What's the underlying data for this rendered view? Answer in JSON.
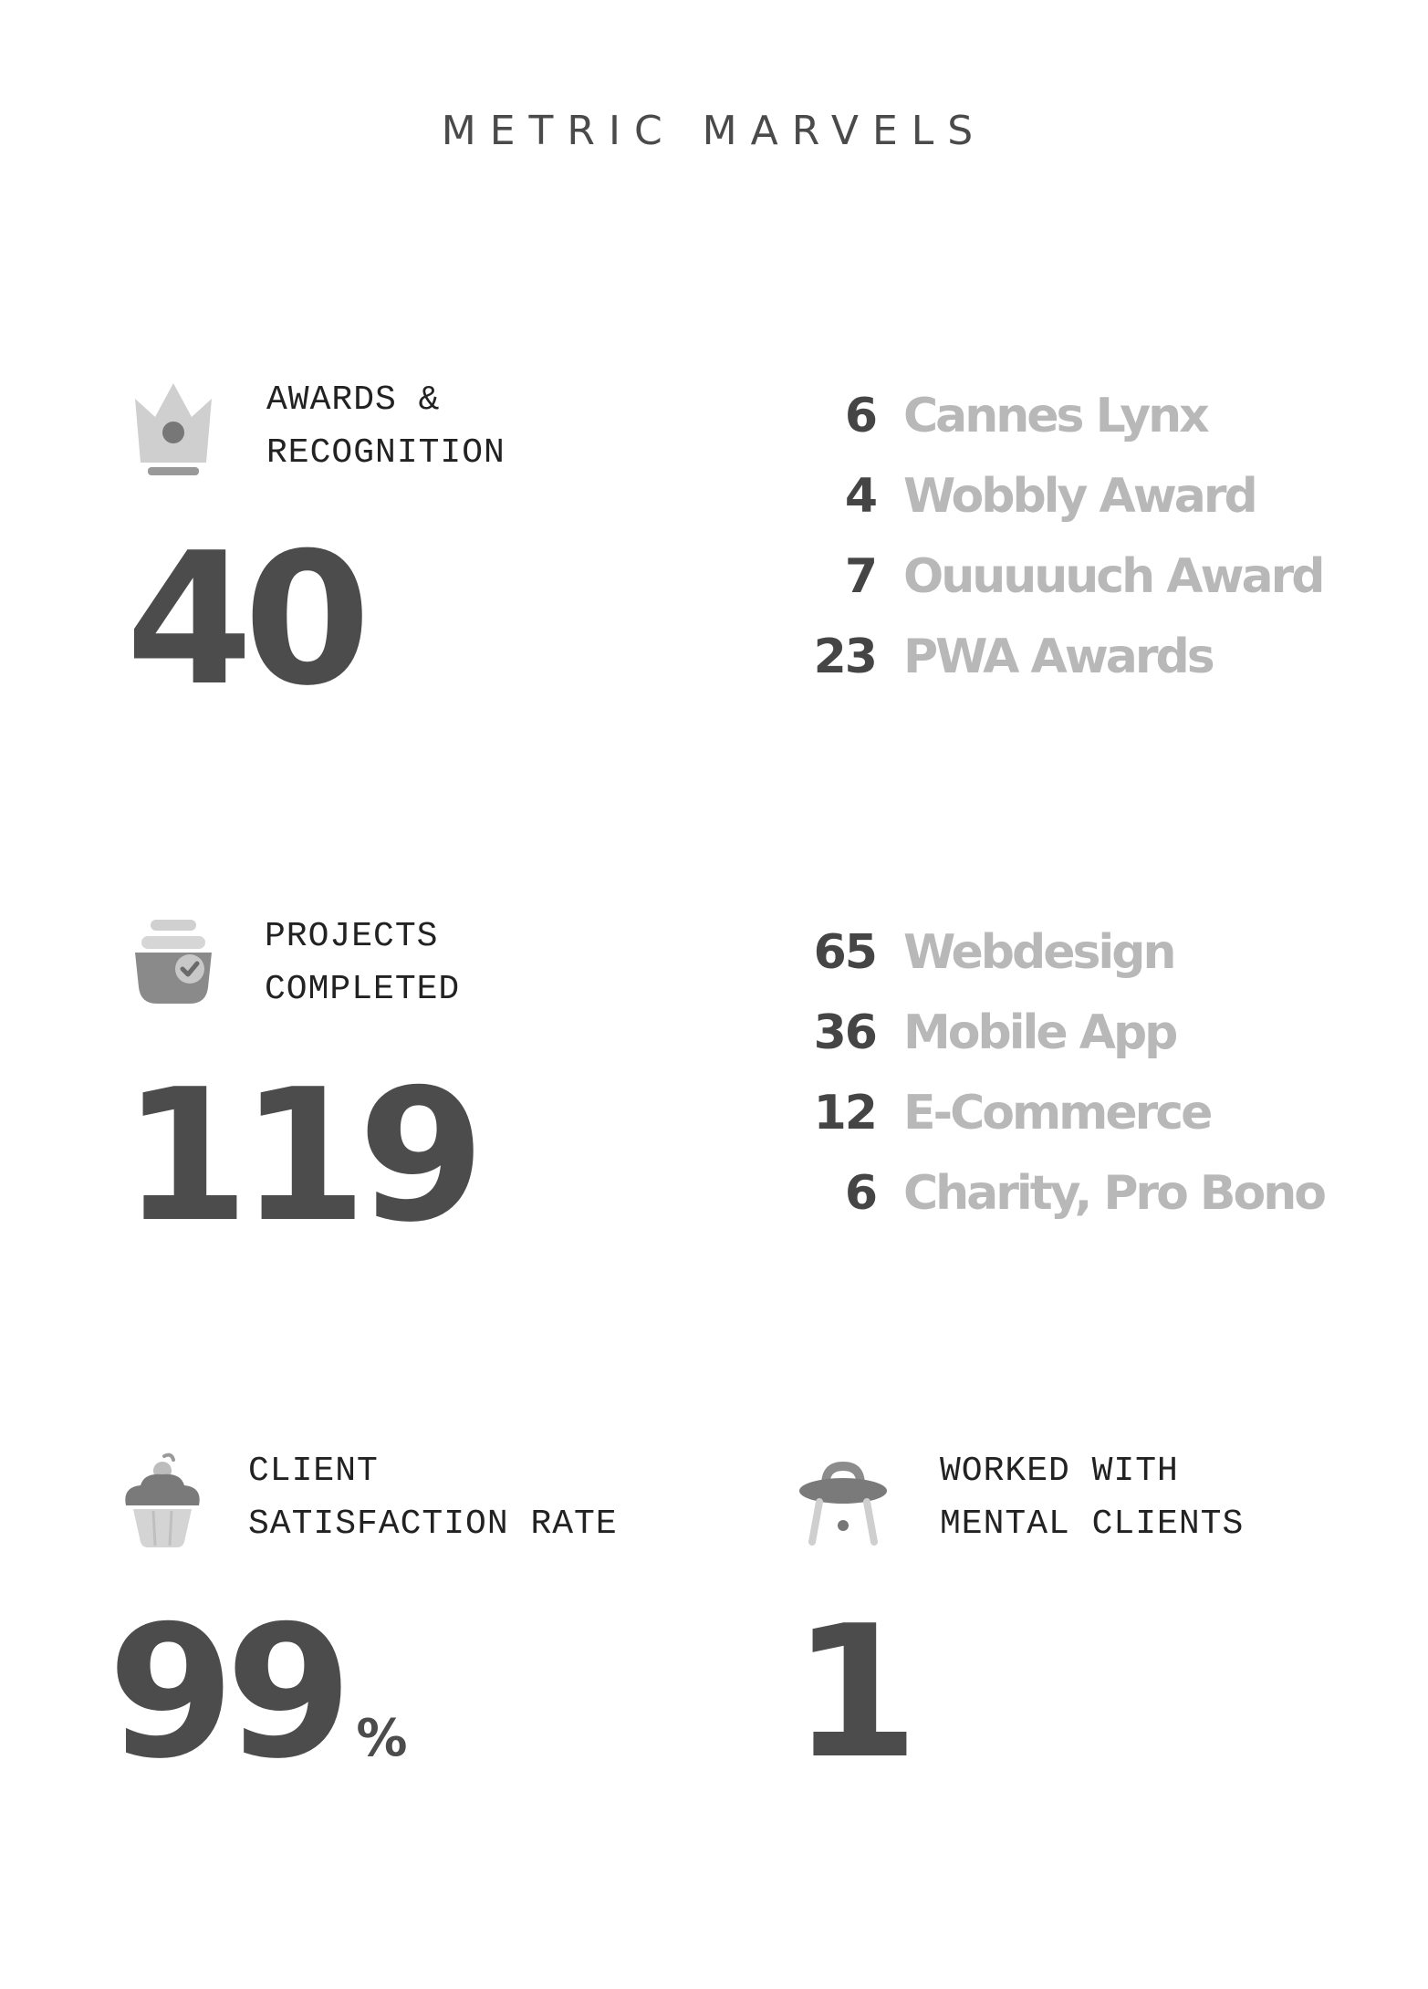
{
  "page_title": "METRIC MARVELS",
  "sections": {
    "awards": {
      "icon": "crown-icon",
      "label_line1": "AWARDS &",
      "label_line2": "RECOGNITION",
      "value": "40",
      "breakdown": [
        {
          "count": "6",
          "name": "Cannes Lynx"
        },
        {
          "count": "4",
          "name": "Wobbly Award"
        },
        {
          "count": "7",
          "name": "Ouuuuuch Award"
        },
        {
          "count": "23",
          "name": "PWA Awards"
        }
      ]
    },
    "projects": {
      "icon": "pot-check-icon",
      "label_line1": "PROJECTS",
      "label_line2": "COMPLETED",
      "value": "119",
      "breakdown": [
        {
          "count": "65",
          "name": "Webdesign"
        },
        {
          "count": "36",
          "name": "Mobile App"
        },
        {
          "count": "12",
          "name": "E-Commerce"
        },
        {
          "count": "6",
          "name": "Charity, Pro Bono"
        }
      ]
    },
    "satisfaction": {
      "icon": "cupcake-icon",
      "label_line1": "CLIENT",
      "label_line2": "SATISFACTION RATE",
      "value": "99",
      "unit": "%"
    },
    "mental_clients": {
      "icon": "ufo-icon",
      "label_line1": "WORKED WITH",
      "label_line2": "MENTAL CLIENTS",
      "value": "1"
    }
  },
  "colors": {
    "number": "#4c4c4c",
    "breakdown_name": "#b8b8b8",
    "icon_light": "#c8c8c8",
    "icon_mid": "#999999",
    "icon_dark": "#6e6e6e"
  }
}
